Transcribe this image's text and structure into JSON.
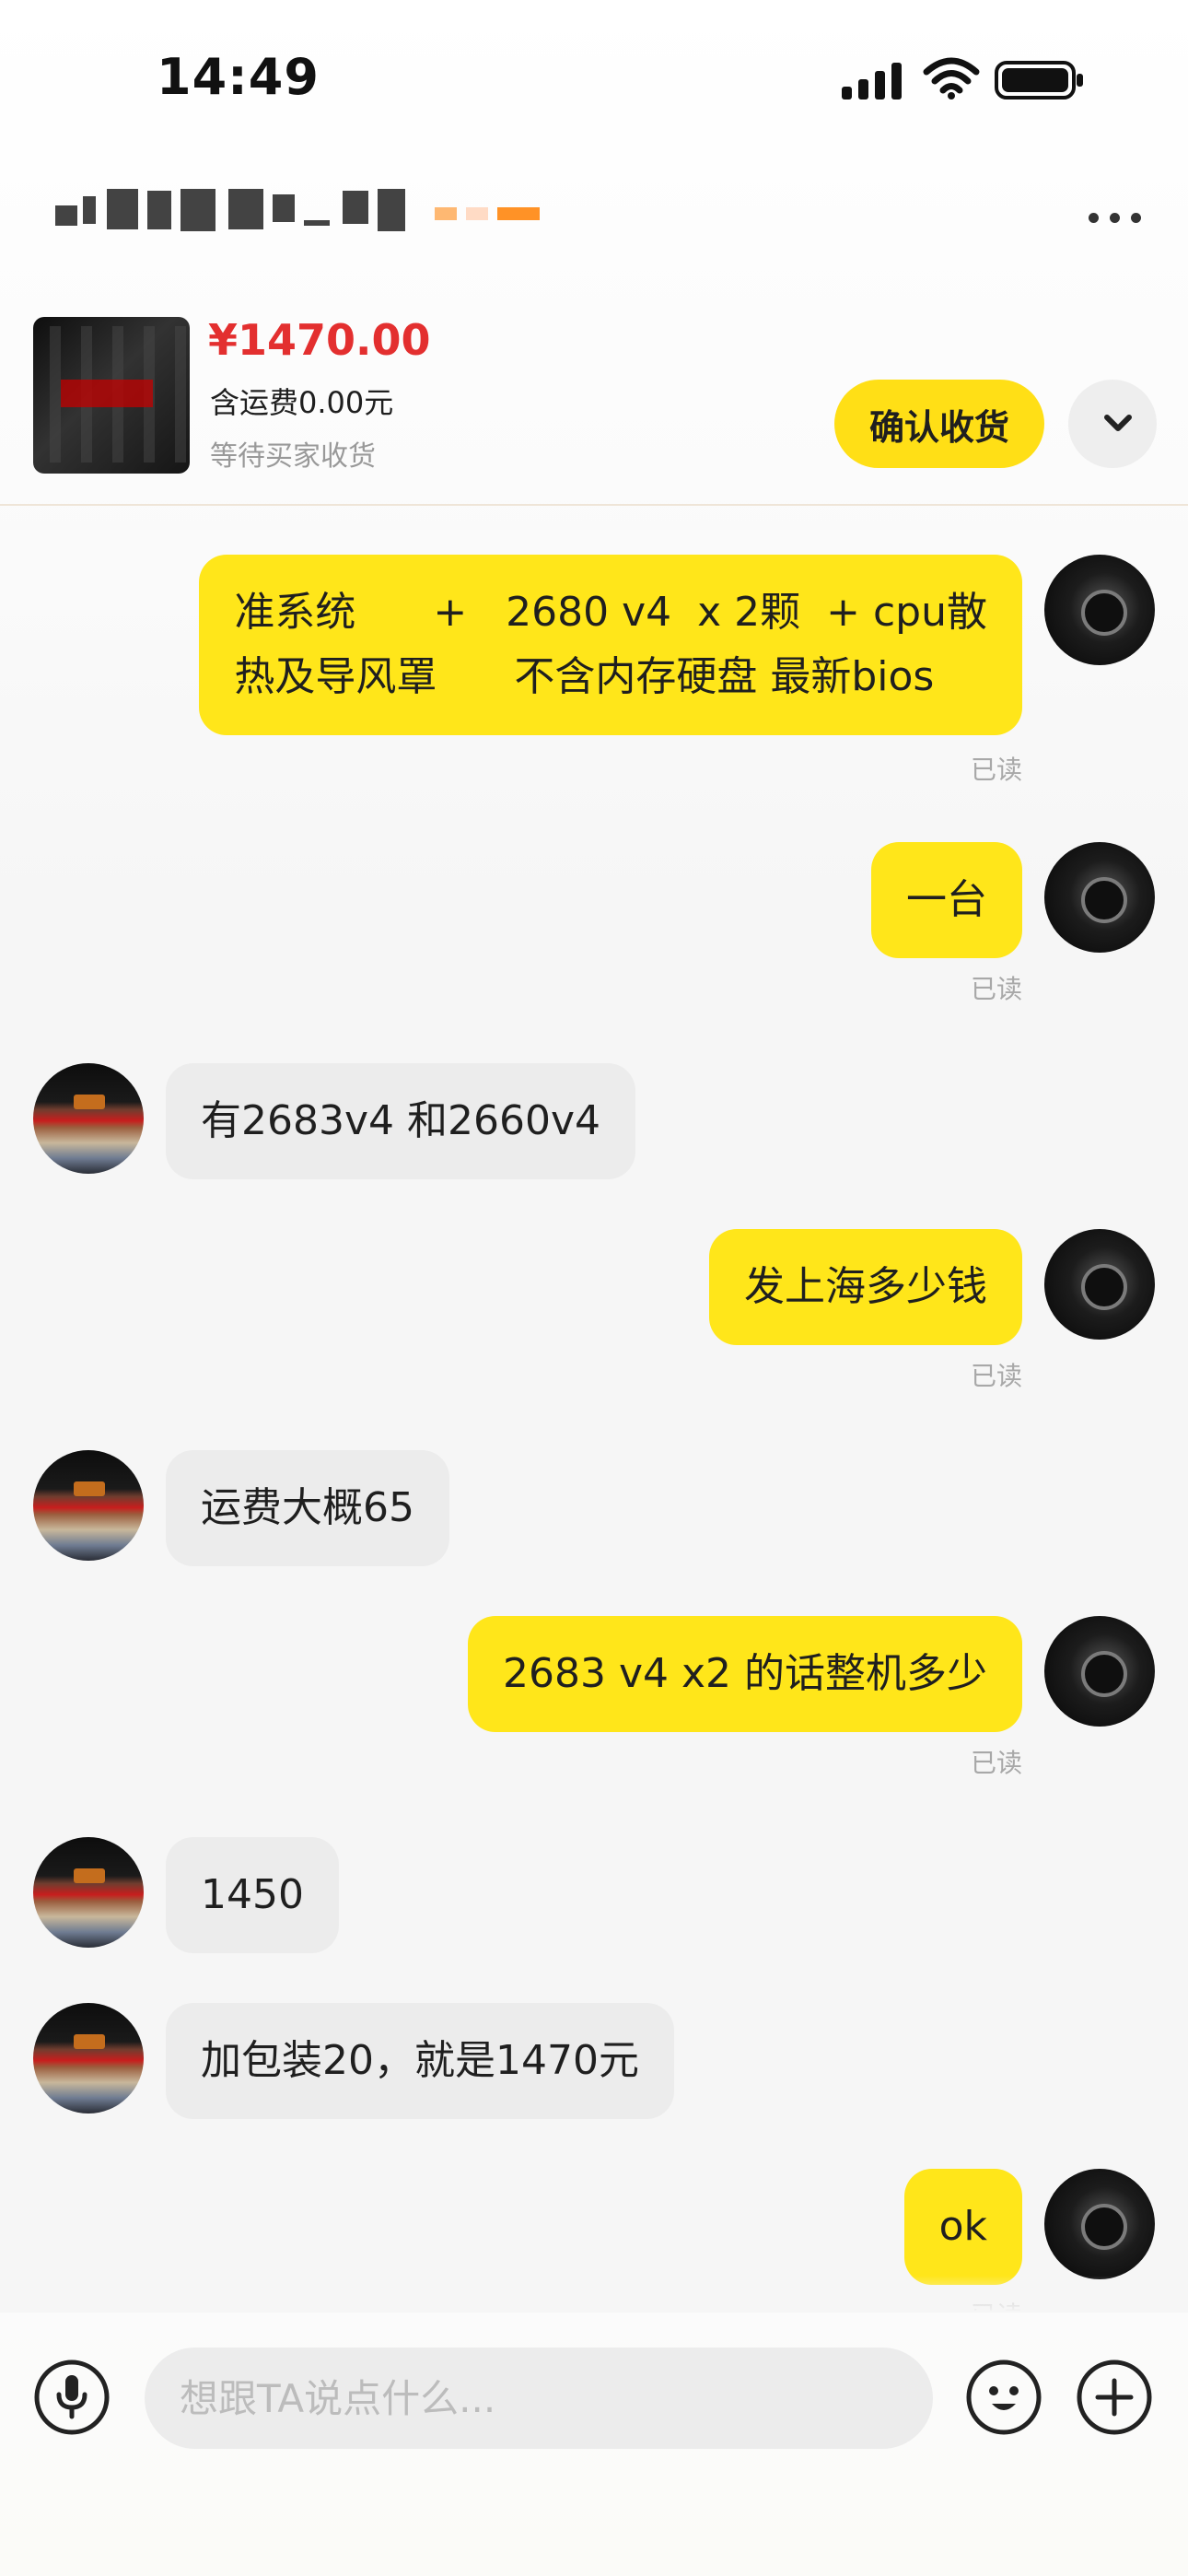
{
  "status_bar": {
    "time": "14:49"
  },
  "header": {
    "more_icon": "more-horizontal-icon"
  },
  "product": {
    "price": "¥1470.00",
    "shipping": "含运费0.00元",
    "status": "等待买家收货",
    "confirm_button": "确认收货",
    "expand_icon": "chevron-down-icon"
  },
  "messages": [
    {
      "sender": "me",
      "text": "准系统      +   2680 v4  x 2颗  + cpu散\n热及导风罩      不含内存硬盘 最新bios",
      "read": "已读"
    },
    {
      "sender": "me",
      "text": "一台",
      "read": "已读"
    },
    {
      "sender": "other",
      "text": "有2683v4 和2660v4"
    },
    {
      "sender": "me",
      "text": "发上海多少钱",
      "read": "已读"
    },
    {
      "sender": "other",
      "text": "运费大概65"
    },
    {
      "sender": "me",
      "text": "2683 v4 x2 的话整机多少",
      "read": "已读"
    },
    {
      "sender": "other",
      "text": "1450"
    },
    {
      "sender": "other",
      "text": "加包装20，就是1470元"
    },
    {
      "sender": "me",
      "text": "ok",
      "read": "已读"
    }
  ],
  "input": {
    "placeholder": "想跟TA说点什么..."
  },
  "icons": {
    "voice": "microphone-icon",
    "emoji": "emoji-icon",
    "plus": "plus-icon"
  },
  "colors": {
    "accent": "#ffe61a",
    "price": "#e32f2f",
    "incoming_bubble": "#ececec"
  }
}
